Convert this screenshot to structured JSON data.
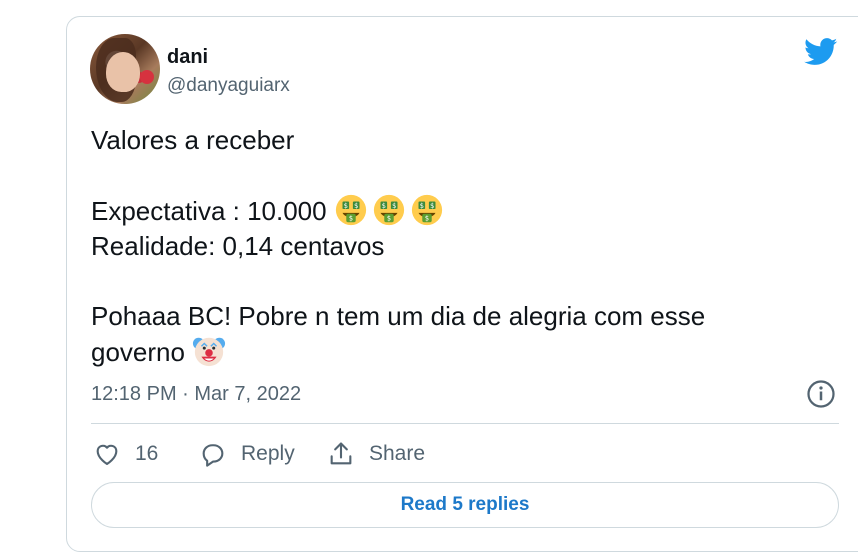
{
  "tweet": {
    "author": {
      "name": "dani",
      "handle": "@danyaguiarx"
    },
    "text": {
      "line1": "Valores a receber",
      "line2": "Expectativa : 10.000",
      "line3": "Realidade: 0,14 centavos",
      "line4": "Pohaaa BC! Pobre n tem um dia de alegria com esse",
      "line5": "governo"
    },
    "emojis": {
      "money_mouth": "money-mouth-face",
      "clown": "clown-face"
    },
    "timestamp": "12:18 PM · Mar 7, 2022",
    "actions": {
      "like_count": "16",
      "reply_label": "Reply",
      "share_label": "Share"
    },
    "read_replies_label": "Read 5 replies"
  },
  "colors": {
    "twitter_blue": "#1d9bf0",
    "link_blue": "#1d79c9",
    "secondary_text": "#536471",
    "border": "#cfd9de"
  }
}
